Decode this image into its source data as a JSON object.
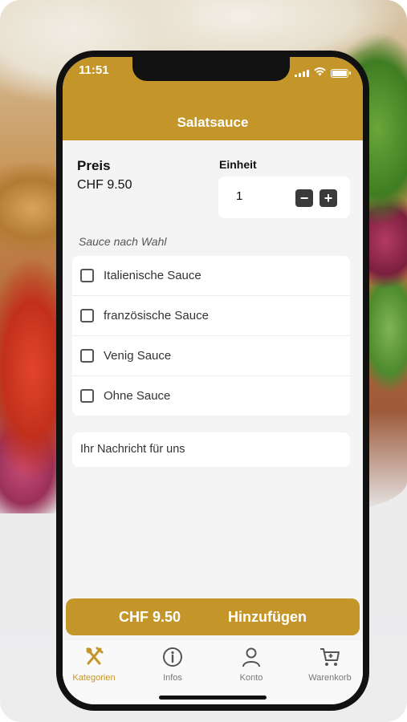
{
  "status_bar": {
    "time": "11:51"
  },
  "header": {
    "title": "Salatsauce"
  },
  "price": {
    "label": "Preis",
    "value": "CHF  9.50"
  },
  "unit": {
    "label": "Einheit",
    "quantity": "1",
    "minus": "−",
    "plus": "+"
  },
  "sauce": {
    "section_label": "Sauce nach Wahl",
    "options": [
      {
        "label": "Italienische Sauce",
        "checked": false
      },
      {
        "label": "französische Sauce",
        "checked": false
      },
      {
        "label": "Venig Sauce",
        "checked": false
      },
      {
        "label": "Ohne Sauce",
        "checked": false
      }
    ]
  },
  "message": {
    "placeholder": "Ihr Nachricht für uns"
  },
  "add_button": {
    "price": "CHF  9.50",
    "label": "Hinzufügen"
  },
  "tabbar": {
    "tabs": [
      {
        "label": "Kategorien",
        "icon": "fork-knife-icon",
        "active": true
      },
      {
        "label": "Infos",
        "icon": "info-icon",
        "active": false
      },
      {
        "label": "Konto",
        "icon": "user-icon",
        "active": false
      },
      {
        "label": "Warenkorb",
        "icon": "cart-icon",
        "active": false
      }
    ]
  },
  "colors": {
    "accent": "#c4962a",
    "background": "#f4f4f4"
  }
}
